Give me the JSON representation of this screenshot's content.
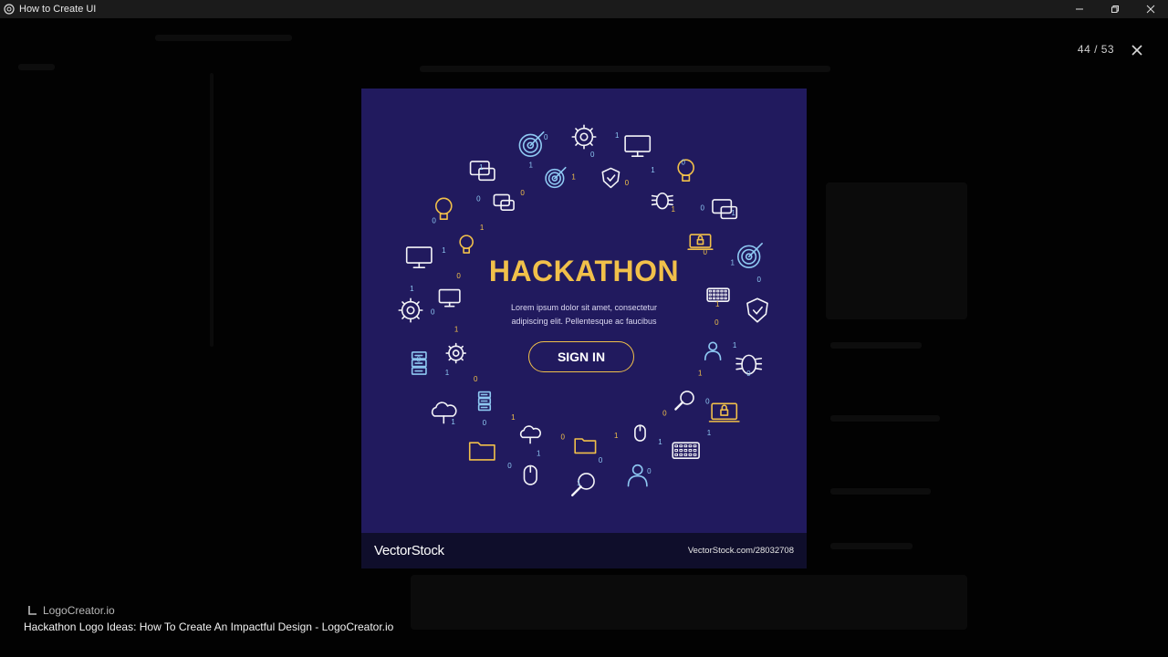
{
  "window": {
    "title": "How to Create UI",
    "minimize_icon": "minimize-icon",
    "maximize_icon": "restore-icon",
    "close_icon": "close-icon"
  },
  "viewer": {
    "counter": "44 / 53",
    "close_icon": "close-icon"
  },
  "image": {
    "heading": "HACKATHON",
    "body_text": "Lorem ipsum dolor sit amet, consectetur adipiscing elit. Pellentesque ac faucibus",
    "button_label": "SIGN IN",
    "watermark_brand": "VectorStock",
    "watermark_url": "VectorStock.com/28032708"
  },
  "caption": {
    "source": "LogoCreator.io",
    "title": "Hackathon Logo Ideas: How To Create An Impactful Design - LogoCreator.io"
  },
  "colors": {
    "poster_bg": "#211a5e",
    "accent_gold": "#f1c04a",
    "icon_blue": "#8ec8f2",
    "titlebar": "#1b1b1b"
  }
}
